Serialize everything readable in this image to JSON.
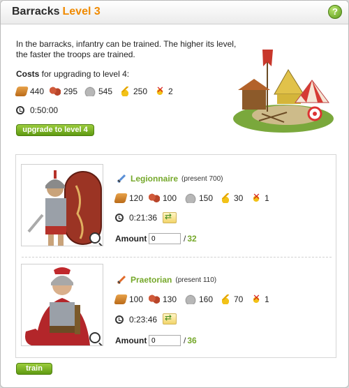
{
  "window": {
    "title": "Barracks",
    "level_label": "Level 3",
    "help_label": "?"
  },
  "building": {
    "description": "In the barracks, infantry can be trained. The higher its level, the faster the troops are trained.",
    "costs_word": "Costs",
    "costs_rest": " for upgrading to level 4:",
    "costs": {
      "wood": "440",
      "clay": "295",
      "iron": "545",
      "crop": "250",
      "upkeep": "2"
    },
    "time": "0:50:00",
    "upgrade_button": "upgrade to level 4"
  },
  "units": [
    {
      "name": "Legionnaire",
      "present": "(present 700)",
      "costs": {
        "wood": "120",
        "clay": "100",
        "iron": "150",
        "crop": "30",
        "upkeep": "1"
      },
      "time": "0:21:36",
      "amount_label": "Amount",
      "amount_value": "0",
      "max": "32"
    },
    {
      "name": "Praetorian",
      "present": "(present 110)",
      "costs": {
        "wood": "100",
        "clay": "130",
        "iron": "160",
        "crop": "70",
        "upkeep": "1"
      },
      "time": "0:23:46",
      "amount_label": "Amount",
      "amount_value": "0",
      "max": "36"
    }
  ],
  "train_button": "train",
  "icons": {
    "wood": "wood-icon",
    "clay": "clay-icon",
    "iron": "iron-icon",
    "crop": "crop-icon",
    "upkeep": "upkeep-icon",
    "clock": "clock-icon",
    "exchange": "npc-exchange-icon",
    "zoom": "zoom-icon",
    "sword": "sword-icon"
  },
  "colors": {
    "accent_level": "#f08a00",
    "accent_green": "#75a82a",
    "button_green": "#6aa81a"
  }
}
